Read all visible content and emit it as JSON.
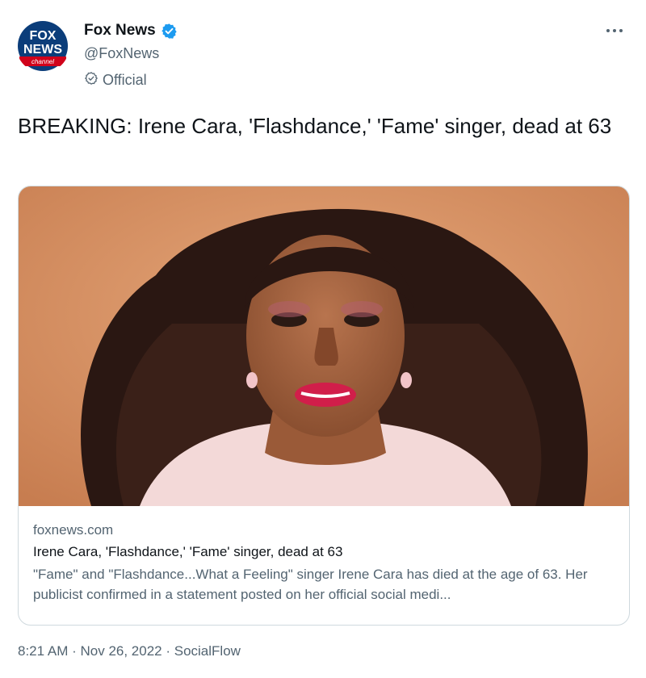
{
  "author": {
    "display_name": "Fox News",
    "handle": "@FoxNews",
    "label": "Official",
    "avatar": {
      "logo_line1": "FOX",
      "logo_line2": "NEWS",
      "logo_line3": "channel"
    }
  },
  "tweet": {
    "text": "BREAKING: Irene Cara, 'Flashdance,' 'Fame' singer, dead at 63"
  },
  "card": {
    "domain": "foxnews.com",
    "title": "Irene Cara, 'Flashdance,' 'Fame' singer, dead at 63",
    "description": "\"Fame\" and \"Flashdance...What a Feeling\" singer Irene Cara has died at the age of 63. Her publicist confirmed in a statement posted on her official social medi..."
  },
  "meta": {
    "time": "8:21 AM",
    "separator": " · ",
    "date": "Nov 26, 2022",
    "source": "SocialFlow"
  },
  "icons": {
    "verified": "verified-badge-icon",
    "official": "official-check-icon",
    "more": "more-dots-icon"
  },
  "colors": {
    "verified_blue": "#1d9bf0",
    "secondary_text": "#536471",
    "primary_text": "#0f1419",
    "card_border": "#cfd9de",
    "fox_blue": "#003a78",
    "fox_red": "#d0021b"
  }
}
